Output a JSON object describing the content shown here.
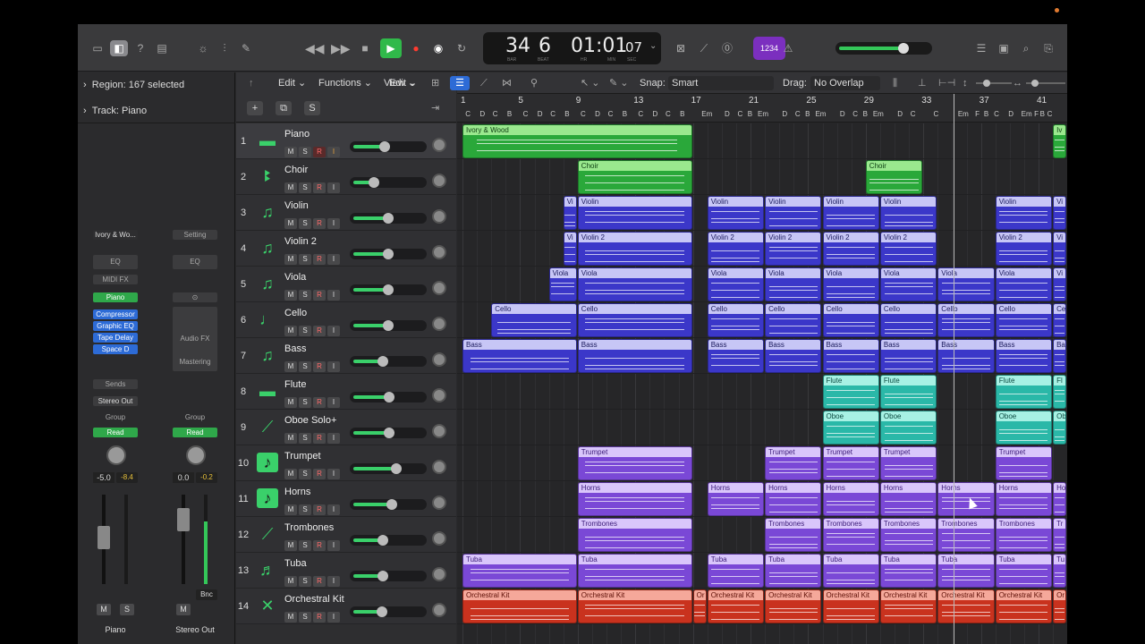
{
  "toolbar": {
    "lcd": {
      "bar": "34",
      "beat": "6",
      "time": "01:01",
      "sec": "07",
      "bar_lbl": "BAR",
      "beat_lbl": "BEAT",
      "hr_lbl": "HR",
      "min_lbl": "MIN",
      "sec_lbl": "SEC"
    },
    "tempo_badge": "1234",
    "master_volume": 0.68
  },
  "inspector": {
    "region": "Region: 167 selected",
    "track": "Track: Piano",
    "strip1": {
      "setting": "Ivory & Wo...",
      "eq": "EQ",
      "midifx": "MIDI FX",
      "instrument": "Piano",
      "fx": [
        "Compressor",
        "Graphic EQ",
        "Tape Delay",
        "Space D"
      ],
      "sends": "Sends",
      "output": "Stereo Out",
      "group": "Group",
      "auto": "Read",
      "vol1": "-5.0",
      "vol2": "-8.4",
      "m": "M",
      "s": "S",
      "name": "Piano"
    },
    "strip2": {
      "setting": "Setting",
      "eq": "EQ",
      "audiofx": "Audio FX",
      "mastering": "Mastering",
      "group": "Group",
      "auto": "Read",
      "vol1": "0.0",
      "vol2": "-0.2",
      "bnc": "Bnc",
      "m": "M",
      "name": "Stereo Out"
    }
  },
  "tracklist": {
    "add": "+",
    "dup": "⧉",
    "s": "S",
    "tracks": [
      {
        "num": "1",
        "name": "Piano",
        "icon": "keyboard-icon",
        "vol": 0.45
      },
      {
        "num": "2",
        "name": "Choir",
        "icon": "choir-icon",
        "vol": 0.28
      },
      {
        "num": "3",
        "name": "Violin",
        "icon": "strings-icon",
        "vol": 0.5
      },
      {
        "num": "4",
        "name": "Violin 2",
        "icon": "strings-icon",
        "vol": 0.5
      },
      {
        "num": "5",
        "name": "Viola",
        "icon": "strings-icon",
        "vol": 0.5
      },
      {
        "num": "6",
        "name": "Cello",
        "icon": "cello-icon",
        "vol": 0.5
      },
      {
        "num": "7",
        "name": "Bass",
        "icon": "strings-icon",
        "vol": 0.42
      },
      {
        "num": "8",
        "name": "Flute",
        "icon": "keyboard-icon",
        "vol": 0.52
      },
      {
        "num": "9",
        "name": "Oboe Solo+",
        "icon": "oboe-icon",
        "vol": 0.52
      },
      {
        "num": "10",
        "name": "Trumpet",
        "icon": "music-note-icon",
        "vol": 0.62
      },
      {
        "num": "11",
        "name": "Horns",
        "icon": "music-note-icon",
        "vol": 0.55
      },
      {
        "num": "12",
        "name": "Trombones",
        "icon": "trombone-icon",
        "vol": 0.42
      },
      {
        "num": "13",
        "name": "Tuba",
        "icon": "tuba-icon",
        "vol": 0.42
      },
      {
        "num": "14",
        "name": "Orchestral Kit",
        "icon": "drumsticks-icon",
        "vol": 0.4
      }
    ],
    "btn_m": "M",
    "btn_s": "S",
    "btn_r": "R",
    "btn_i": "I"
  },
  "arrange": {
    "edit": "Edit",
    "functions": "Functions",
    "view": "View",
    "snap_label": "Snap:",
    "snap_value": "Smart",
    "drag_label": "Drag:",
    "drag_value": "No Overlap",
    "bars": [
      "1",
      "5",
      "9",
      "13",
      "17",
      "21",
      "25",
      "29",
      "33",
      "37",
      "41"
    ],
    "chords": [
      {
        "t": "C",
        "x": 0.2
      },
      {
        "t": "D",
        "x": 1.2
      },
      {
        "t": "C",
        "x": 2.1
      },
      {
        "t": "B",
        "x": 3.1
      },
      {
        "t": "C",
        "x": 4.2
      },
      {
        "t": "D",
        "x": 5.2
      },
      {
        "t": "C",
        "x": 6.1
      },
      {
        "t": "B",
        "x": 7.1
      },
      {
        "t": "C",
        "x": 8.2
      },
      {
        "t": "D",
        "x": 9.2
      },
      {
        "t": "C",
        "x": 10.1
      },
      {
        "t": "B",
        "x": 11.1
      },
      {
        "t": "C",
        "x": 12.2
      },
      {
        "t": "D",
        "x": 13.2
      },
      {
        "t": "C",
        "x": 14.1
      },
      {
        "t": "B",
        "x": 15.1
      },
      {
        "t": "Em",
        "x": 16.6
      },
      {
        "t": "D",
        "x": 18.2
      },
      {
        "t": "C",
        "x": 19.1
      },
      {
        "t": "B",
        "x": 19.8
      },
      {
        "t": "Em",
        "x": 20.5
      },
      {
        "t": "D",
        "x": 22.2
      },
      {
        "t": "C",
        "x": 23.1
      },
      {
        "t": "B",
        "x": 23.8
      },
      {
        "t": "Em",
        "x": 24.5
      },
      {
        "t": "D",
        "x": 26.2
      },
      {
        "t": "C",
        "x": 27.1
      },
      {
        "t": "B",
        "x": 27.8
      },
      {
        "t": "Em",
        "x": 28.5
      },
      {
        "t": "D",
        "x": 30.2
      },
      {
        "t": "C",
        "x": 31.1
      },
      {
        "t": "C",
        "x": 32.7
      },
      {
        "t": "Em",
        "x": 34.4
      },
      {
        "t": "F",
        "x": 35.6
      },
      {
        "t": "B",
        "x": 36.2
      },
      {
        "t": "C",
        "x": 36.9
      },
      {
        "t": "D",
        "x": 37.9
      },
      {
        "t": "Em",
        "x": 38.8
      },
      {
        "t": "F",
        "x": 39.7
      },
      {
        "t": "B",
        "x": 40.1
      },
      {
        "t": "C",
        "x": 40.6
      }
    ],
    "regions": [
      {
        "lane": 0,
        "start": 1,
        "end": 17,
        "name": "Ivory & Wood",
        "color": "green"
      },
      {
        "lane": 0,
        "start": 42,
        "end": 43,
        "name": "Iv",
        "color": "green"
      },
      {
        "lane": 1,
        "start": 9,
        "end": 17,
        "name": "Choir",
        "color": "green"
      },
      {
        "lane": 1,
        "start": 29,
        "end": 33,
        "name": "Choir",
        "color": "green"
      },
      {
        "lane": 2,
        "start": 8,
        "end": 9,
        "name": "Vi",
        "color": "blue"
      },
      {
        "lane": 2,
        "start": 9,
        "end": 17,
        "name": "Violin",
        "color": "blue"
      },
      {
        "lane": 2,
        "start": 18,
        "end": 22,
        "name": "Violin",
        "color": "blue"
      },
      {
        "lane": 2,
        "start": 22,
        "end": 26,
        "name": "Violin",
        "color": "blue"
      },
      {
        "lane": 2,
        "start": 26,
        "end": 30,
        "name": "Violin",
        "color": "blue"
      },
      {
        "lane": 2,
        "start": 30,
        "end": 34,
        "name": "Violin",
        "color": "blue"
      },
      {
        "lane": 2,
        "start": 38,
        "end": 42,
        "name": "Violin",
        "color": "blue"
      },
      {
        "lane": 2,
        "start": 42,
        "end": 43,
        "name": "Vi",
        "color": "blue"
      },
      {
        "lane": 3,
        "start": 8,
        "end": 9,
        "name": "Vi",
        "color": "blue"
      },
      {
        "lane": 3,
        "start": 9,
        "end": 17,
        "name": "Violin 2",
        "color": "blue"
      },
      {
        "lane": 3,
        "start": 18,
        "end": 22,
        "name": "Violin 2",
        "color": "blue"
      },
      {
        "lane": 3,
        "start": 22,
        "end": 26,
        "name": "Violin 2",
        "color": "blue"
      },
      {
        "lane": 3,
        "start": 26,
        "end": 30,
        "name": "Violin 2",
        "color": "blue"
      },
      {
        "lane": 3,
        "start": 30,
        "end": 34,
        "name": "Violin 2",
        "color": "blue"
      },
      {
        "lane": 3,
        "start": 38,
        "end": 42,
        "name": "Violin 2",
        "color": "blue"
      },
      {
        "lane": 3,
        "start": 42,
        "end": 43,
        "name": "Vi",
        "color": "blue"
      },
      {
        "lane": 4,
        "start": 7,
        "end": 9,
        "name": "Viola",
        "color": "blue"
      },
      {
        "lane": 4,
        "start": 9,
        "end": 17,
        "name": "Viola",
        "color": "blue"
      },
      {
        "lane": 4,
        "start": 18,
        "end": 22,
        "name": "Viola",
        "color": "blue"
      },
      {
        "lane": 4,
        "start": 22,
        "end": 26,
        "name": "Viola",
        "color": "blue"
      },
      {
        "lane": 4,
        "start": 26,
        "end": 30,
        "name": "Viola",
        "color": "blue"
      },
      {
        "lane": 4,
        "start": 30,
        "end": 34,
        "name": "Viola",
        "color": "blue"
      },
      {
        "lane": 4,
        "start": 34,
        "end": 38,
        "name": "Viola",
        "color": "blue"
      },
      {
        "lane": 4,
        "start": 38,
        "end": 42,
        "name": "Viola",
        "color": "blue"
      },
      {
        "lane": 4,
        "start": 42,
        "end": 43,
        "name": "Vi",
        "color": "blue"
      },
      {
        "lane": 5,
        "start": 3,
        "end": 9,
        "name": "Cello",
        "color": "blue"
      },
      {
        "lane": 5,
        "start": 9,
        "end": 17,
        "name": "Cello",
        "color": "blue"
      },
      {
        "lane": 5,
        "start": 18,
        "end": 22,
        "name": "Cello",
        "color": "blue"
      },
      {
        "lane": 5,
        "start": 22,
        "end": 26,
        "name": "Cello",
        "color": "blue"
      },
      {
        "lane": 5,
        "start": 26,
        "end": 30,
        "name": "Cello",
        "color": "blue"
      },
      {
        "lane": 5,
        "start": 30,
        "end": 34,
        "name": "Cello",
        "color": "blue"
      },
      {
        "lane": 5,
        "start": 34,
        "end": 38,
        "name": "Cello",
        "color": "blue"
      },
      {
        "lane": 5,
        "start": 38,
        "end": 42,
        "name": "Cello",
        "color": "blue"
      },
      {
        "lane": 5,
        "start": 42,
        "end": 43,
        "name": "Ce",
        "color": "blue"
      },
      {
        "lane": 6,
        "start": 1,
        "end": 9,
        "name": "Bass",
        "color": "blue"
      },
      {
        "lane": 6,
        "start": 9,
        "end": 17,
        "name": "Bass",
        "color": "blue"
      },
      {
        "lane": 6,
        "start": 18,
        "end": 22,
        "name": "Bass",
        "color": "blue"
      },
      {
        "lane": 6,
        "start": 22,
        "end": 26,
        "name": "Bass",
        "color": "blue"
      },
      {
        "lane": 6,
        "start": 26,
        "end": 30,
        "name": "Bass",
        "color": "blue"
      },
      {
        "lane": 6,
        "start": 30,
        "end": 34,
        "name": "Bass",
        "color": "blue"
      },
      {
        "lane": 6,
        "start": 34,
        "end": 38,
        "name": "Bass",
        "color": "blue"
      },
      {
        "lane": 6,
        "start": 38,
        "end": 42,
        "name": "Bass",
        "color": "blue"
      },
      {
        "lane": 6,
        "start": 42,
        "end": 43,
        "name": "Ba",
        "color": "blue"
      },
      {
        "lane": 7,
        "start": 26,
        "end": 30,
        "name": "Flute",
        "color": "teal"
      },
      {
        "lane": 7,
        "start": 30,
        "end": 34,
        "name": "Flute",
        "color": "teal"
      },
      {
        "lane": 7,
        "start": 38,
        "end": 42,
        "name": "Flute",
        "color": "teal"
      },
      {
        "lane": 7,
        "start": 42,
        "end": 43,
        "name": "Fl",
        "color": "teal"
      },
      {
        "lane": 8,
        "start": 26,
        "end": 30,
        "name": "Oboe",
        "color": "teal"
      },
      {
        "lane": 8,
        "start": 30,
        "end": 34,
        "name": "Oboe",
        "color": "teal"
      },
      {
        "lane": 8,
        "start": 38,
        "end": 42,
        "name": "Oboe",
        "color": "teal"
      },
      {
        "lane": 8,
        "start": 42,
        "end": 43,
        "name": "Ob",
        "color": "teal"
      },
      {
        "lane": 9,
        "start": 9,
        "end": 17,
        "name": "Trumpet",
        "color": "purple"
      },
      {
        "lane": 9,
        "start": 22,
        "end": 26,
        "name": "Trumpet",
        "color": "purple"
      },
      {
        "lane": 9,
        "start": 26,
        "end": 30,
        "name": "Trumpet",
        "color": "purple"
      },
      {
        "lane": 9,
        "start": 30,
        "end": 34,
        "name": "Trumpet",
        "color": "purple"
      },
      {
        "lane": 9,
        "start": 38,
        "end": 42,
        "name": "Trumpet",
        "color": "purple"
      },
      {
        "lane": 10,
        "start": 9,
        "end": 17,
        "name": "Horns",
        "color": "purple"
      },
      {
        "lane": 10,
        "start": 18,
        "end": 22,
        "name": "Horns",
        "color": "purple"
      },
      {
        "lane": 10,
        "start": 22,
        "end": 26,
        "name": "Horns",
        "color": "purple"
      },
      {
        "lane": 10,
        "start": 26,
        "end": 30,
        "name": "Horns",
        "color": "purple"
      },
      {
        "lane": 10,
        "start": 30,
        "end": 34,
        "name": "Horns",
        "color": "purple"
      },
      {
        "lane": 10,
        "start": 34,
        "end": 38,
        "name": "Horns",
        "color": "purple"
      },
      {
        "lane": 10,
        "start": 38,
        "end": 42,
        "name": "Horns",
        "color": "purple"
      },
      {
        "lane": 10,
        "start": 42,
        "end": 43,
        "name": "Ho",
        "color": "purple"
      },
      {
        "lane": 11,
        "start": 9,
        "end": 17,
        "name": "Trombones",
        "color": "purple"
      },
      {
        "lane": 11,
        "start": 22,
        "end": 26,
        "name": "Trombones",
        "color": "purple"
      },
      {
        "lane": 11,
        "start": 26,
        "end": 30,
        "name": "Trombones",
        "color": "purple"
      },
      {
        "lane": 11,
        "start": 30,
        "end": 34,
        "name": "Trombones",
        "color": "purple"
      },
      {
        "lane": 11,
        "start": 34,
        "end": 38,
        "name": "Trombones",
        "color": "purple"
      },
      {
        "lane": 11,
        "start": 38,
        "end": 42,
        "name": "Trombones",
        "color": "purple"
      },
      {
        "lane": 11,
        "start": 42,
        "end": 43,
        "name": "Tr",
        "color": "purple"
      },
      {
        "lane": 12,
        "start": 1,
        "end": 9,
        "name": "Tuba",
        "color": "purple"
      },
      {
        "lane": 12,
        "start": 9,
        "end": 17,
        "name": "Tuba",
        "color": "purple"
      },
      {
        "lane": 12,
        "start": 18,
        "end": 22,
        "name": "Tuba",
        "color": "purple"
      },
      {
        "lane": 12,
        "start": 22,
        "end": 26,
        "name": "Tuba",
        "color": "purple"
      },
      {
        "lane": 12,
        "start": 26,
        "end": 30,
        "name": "Tuba",
        "color": "purple"
      },
      {
        "lane": 12,
        "start": 30,
        "end": 34,
        "name": "Tuba",
        "color": "purple"
      },
      {
        "lane": 12,
        "start": 34,
        "end": 38,
        "name": "Tuba",
        "color": "purple"
      },
      {
        "lane": 12,
        "start": 38,
        "end": 42,
        "name": "Tuba",
        "color": "purple"
      },
      {
        "lane": 12,
        "start": 42,
        "end": 43,
        "name": "Tu",
        "color": "purple"
      },
      {
        "lane": 13,
        "start": 1,
        "end": 9,
        "name": "Orchestral Kit",
        "color": "red"
      },
      {
        "lane": 13,
        "start": 9,
        "end": 17,
        "name": "Orchestral Kit",
        "color": "red"
      },
      {
        "lane": 13,
        "start": 17,
        "end": 18,
        "name": "Or",
        "color": "red"
      },
      {
        "lane": 13,
        "start": 18,
        "end": 22,
        "name": "Orchestral Kit",
        "color": "red"
      },
      {
        "lane": 13,
        "start": 22,
        "end": 26,
        "name": "Orchestral Kit",
        "color": "red"
      },
      {
        "lane": 13,
        "start": 26,
        "end": 30,
        "name": "Orchestral Kit",
        "color": "red"
      },
      {
        "lane": 13,
        "start": 30,
        "end": 34,
        "name": "Orchestral Kit",
        "color": "red"
      },
      {
        "lane": 13,
        "start": 34,
        "end": 38,
        "name": "Orchestral Kit",
        "color": "red"
      },
      {
        "lane": 13,
        "start": 38,
        "end": 42,
        "name": "Orchestral Kit",
        "color": "red"
      },
      {
        "lane": 13,
        "start": 42,
        "end": 43,
        "name": "Or",
        "color": "red"
      }
    ]
  },
  "colors": {
    "accent_green": "#3ad06a",
    "region_blue": "#3b37c9",
    "region_purple": "#7a48d6",
    "region_red": "#c9321e",
    "region_teal": "#2ab8a8"
  }
}
